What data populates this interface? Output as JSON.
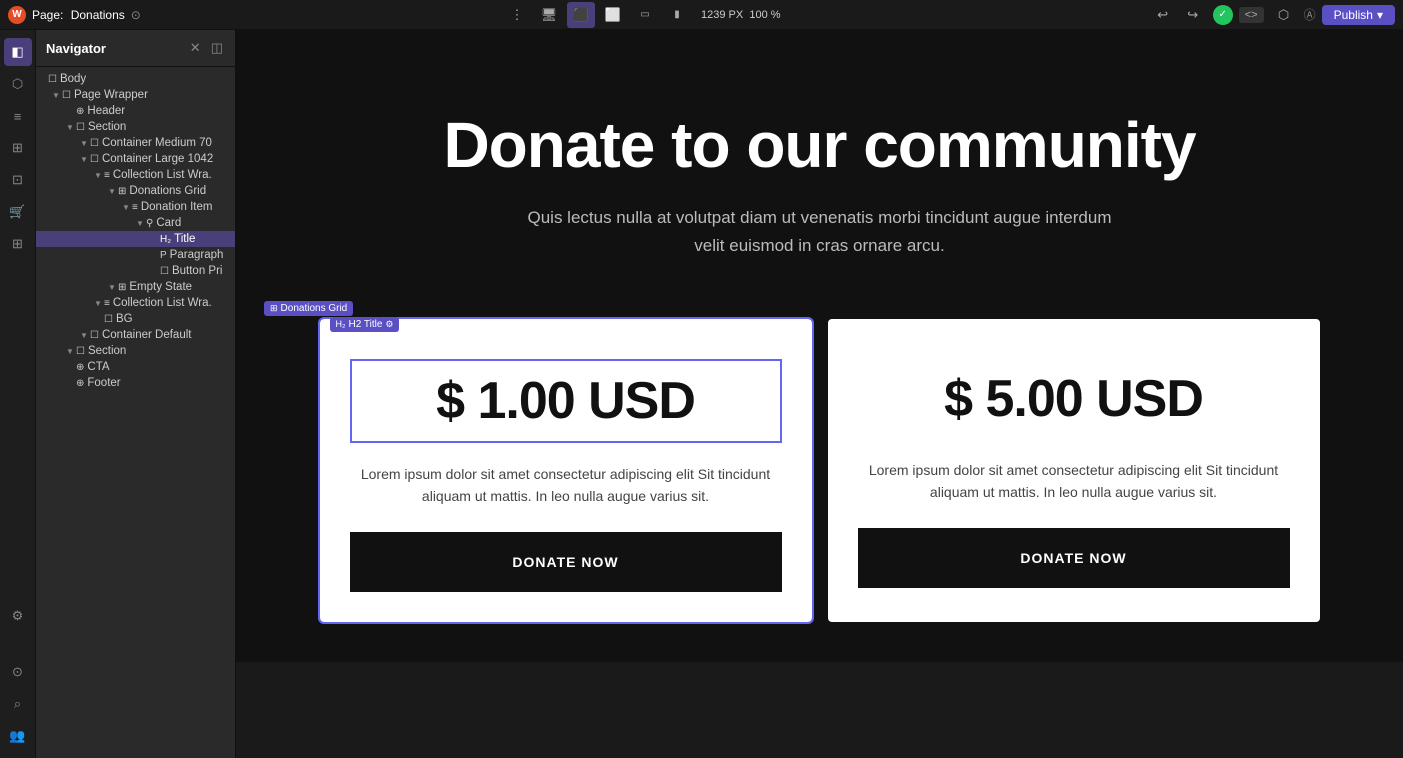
{
  "topbar": {
    "logo_text": "W",
    "page_label": "Page:",
    "page_name": "Donations",
    "px_display": "1239 PX",
    "zoom_display": "100 %",
    "publish_label": "Publish"
  },
  "navigator": {
    "title": "Navigator",
    "tree": [
      {
        "id": "body",
        "label": "Body",
        "indent": 0,
        "type": "box",
        "arrow": false,
        "icon": "☐"
      },
      {
        "id": "page-wrapper",
        "label": "Page Wrapper",
        "indent": 1,
        "type": "box",
        "arrow": true,
        "icon": "☐"
      },
      {
        "id": "header",
        "label": "Header",
        "indent": 2,
        "type": "component",
        "arrow": false,
        "icon": "⊕"
      },
      {
        "id": "section1",
        "label": "Section",
        "indent": 2,
        "type": "box",
        "arrow": true,
        "icon": "☐"
      },
      {
        "id": "container-medium",
        "label": "Container Medium 70",
        "indent": 3,
        "type": "box",
        "arrow": true,
        "icon": "☐"
      },
      {
        "id": "container-large",
        "label": "Container Large 1042",
        "indent": 3,
        "type": "box",
        "arrow": true,
        "icon": "☐"
      },
      {
        "id": "collection-list-wrap",
        "label": "Collection List Wra.",
        "indent": 4,
        "type": "list",
        "arrow": true,
        "icon": "≡"
      },
      {
        "id": "donations-grid",
        "label": "Donations Grid",
        "indent": 5,
        "type": "grid",
        "arrow": true,
        "icon": "⊞"
      },
      {
        "id": "donation-item",
        "label": "Donation Item",
        "indent": 6,
        "type": "list",
        "arrow": true,
        "icon": "≡"
      },
      {
        "id": "card",
        "label": "Card",
        "indent": 7,
        "type": "link",
        "arrow": true,
        "icon": "⚲"
      },
      {
        "id": "title",
        "label": "Title",
        "indent": 8,
        "type": "h2",
        "arrow": false,
        "icon": "H₂",
        "selected": true
      },
      {
        "id": "paragraph",
        "label": "Paragraph",
        "indent": 8,
        "type": "p",
        "arrow": false,
        "icon": "P"
      },
      {
        "id": "button-pri",
        "label": "Button Pri",
        "indent": 8,
        "type": "box",
        "arrow": false,
        "icon": "☐"
      },
      {
        "id": "empty-state",
        "label": "Empty State",
        "indent": 5,
        "type": "grid",
        "arrow": true,
        "icon": "⊞"
      },
      {
        "id": "collection-list-wrap2",
        "label": "Collection List Wra.",
        "indent": 4,
        "type": "list",
        "arrow": true,
        "icon": "≡"
      },
      {
        "id": "bg",
        "label": "BG",
        "indent": 4,
        "type": "box",
        "arrow": false,
        "icon": "☐"
      },
      {
        "id": "container-default",
        "label": "Container Default",
        "indent": 3,
        "type": "box",
        "arrow": true,
        "icon": "☐"
      },
      {
        "id": "section2",
        "label": "Section",
        "indent": 2,
        "type": "box",
        "arrow": true,
        "icon": "☐"
      },
      {
        "id": "cta",
        "label": "CTA",
        "indent": 2,
        "type": "component",
        "arrow": false,
        "icon": "⊕"
      },
      {
        "id": "footer",
        "label": "Footer",
        "indent": 2,
        "type": "component",
        "arrow": false,
        "icon": "⊕"
      }
    ]
  },
  "canvas": {
    "hero": {
      "title": "Donate to our community",
      "subtitle": "Quis lectus nulla at volutpat diam ut venenatis morbi tincidunt augue interdum velit euismod in cras ornare arcu."
    },
    "grid_label": "Donations Grid",
    "card_title_label": "H2 Title",
    "cards": [
      {
        "amount": "$ 1.00 USD",
        "description": "Lorem ipsum dolor sit amet consectetur adipiscing elit Sit tincidunt aliquam ut mattis. In leo nulla augue varius sit.",
        "button_label": "DONATE NOW"
      },
      {
        "amount": "$ 5.00 USD",
        "description": "Lorem ipsum dolor sit amet consectetur adipiscing elit Sit tincidunt aliquam ut mattis. In leo nulla augue varius sit.",
        "button_label": "DONATE NOW"
      }
    ]
  },
  "icons": {
    "layers": "◧",
    "components": "⬡",
    "styles": "≡",
    "assets": "⊞",
    "pages": "⊡",
    "store": "🛒",
    "apps": "⊞",
    "settings": "⚙",
    "search": "⌕",
    "team": "👥",
    "close": "✕",
    "collapse": "◫",
    "undo": "↩",
    "redo": "↪",
    "devices": {
      "desktop_large": "🖥",
      "desktop": "⊟",
      "tablet_h": "⬜",
      "tablet_v": "⬜",
      "mobile": "▭"
    }
  }
}
